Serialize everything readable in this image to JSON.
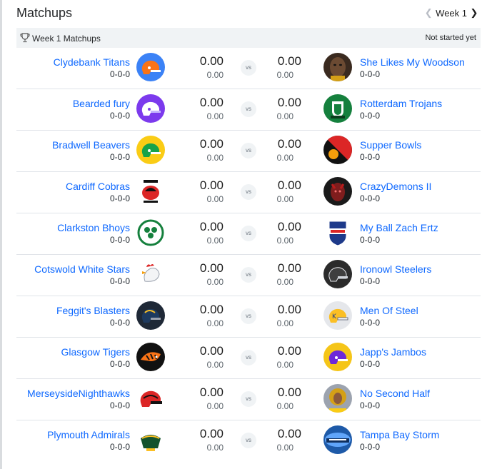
{
  "header": {
    "title": "Matchups",
    "week_label": "Week 1",
    "prev_icon": "chevron-left-icon",
    "next_icon": "chevron-right-icon"
  },
  "subheader": {
    "icon": "trophy-icon",
    "title": "Week 1 Matchups",
    "status": "Not started yet"
  },
  "vs_label": "vs",
  "matchups": [
    {
      "left": {
        "name": "Clydebank Titans",
        "record": "0-0-0",
        "score": "0.00",
        "proj": "0.00"
      },
      "right": {
        "name": "She Likes My Woodson",
        "record": "0-0-0",
        "score": "0.00",
        "proj": "0.00"
      }
    },
    {
      "left": {
        "name": "Bearded fury",
        "record": "0-0-0",
        "score": "0.00",
        "proj": "0.00"
      },
      "right": {
        "name": "Rotterdam Trojans",
        "record": "0-0-0",
        "score": "0.00",
        "proj": "0.00"
      }
    },
    {
      "left": {
        "name": "Bradwell Beavers",
        "record": "0-0-0",
        "score": "0.00",
        "proj": "0.00"
      },
      "right": {
        "name": "Supper Bowls",
        "record": "0-0-0",
        "score": "0.00",
        "proj": "0.00"
      }
    },
    {
      "left": {
        "name": "Cardiff Cobras",
        "record": "0-0-0",
        "score": "0.00",
        "proj": "0.00"
      },
      "right": {
        "name": "CrazyDemons II",
        "record": "0-0-0",
        "score": "0.00",
        "proj": "0.00"
      }
    },
    {
      "left": {
        "name": "Clarkston Bhoys",
        "record": "0-0-0",
        "score": "0.00",
        "proj": "0.00"
      },
      "right": {
        "name": "My Ball Zach Ertz",
        "record": "0-0-0",
        "score": "0.00",
        "proj": "0.00"
      }
    },
    {
      "left": {
        "name": "Cotswold White Stars",
        "record": "0-0-0",
        "score": "0.00",
        "proj": "0.00"
      },
      "right": {
        "name": "Ironowl Steelers",
        "record": "0-0-0",
        "score": "0.00",
        "proj": "0.00"
      }
    },
    {
      "left": {
        "name": "Feggit's Blasters",
        "record": "0-0-0",
        "score": "0.00",
        "proj": "0.00"
      },
      "right": {
        "name": "Men Of Steel",
        "record": "0-0-0",
        "score": "0.00",
        "proj": "0.00"
      }
    },
    {
      "left": {
        "name": "Glasgow Tigers",
        "record": "0-0-0",
        "score": "0.00",
        "proj": "0.00"
      },
      "right": {
        "name": "Japp's Jambos",
        "record": "0-0-0",
        "score": "0.00",
        "proj": "0.00"
      }
    },
    {
      "left": {
        "name": "MerseysideNighthawks",
        "record": "0-0-0",
        "score": "0.00",
        "proj": "0.00"
      },
      "right": {
        "name": "No Second Half",
        "record": "0-0-0",
        "score": "0.00",
        "proj": "0.00"
      }
    },
    {
      "left": {
        "name": "Plymouth Admirals",
        "record": "0-0-0",
        "score": "0.00",
        "proj": "0.00"
      },
      "right": {
        "name": "Tampa Bay Storm",
        "record": "0-0-0",
        "score": "0.00",
        "proj": "0.00"
      }
    }
  ],
  "logos": {
    "colors": {
      "orange_helmet_bg": "#3b82f6",
      "purple_helmet_bg": "#7c3aed",
      "yellow_helmet_bg": "#facc15",
      "green_crest_bg": "#15803d",
      "red_bowl_bg": "#dc2626",
      "demon_bg": "#1a1a1a",
      "nfl_blue": "#1e3a8a",
      "steelers_bg": "#2b2b2b",
      "gold_helmet_bg": "#e5e7eb",
      "purple_jambos_bg": "#f5c518",
      "storm_bg": "#1e5aa8"
    }
  }
}
